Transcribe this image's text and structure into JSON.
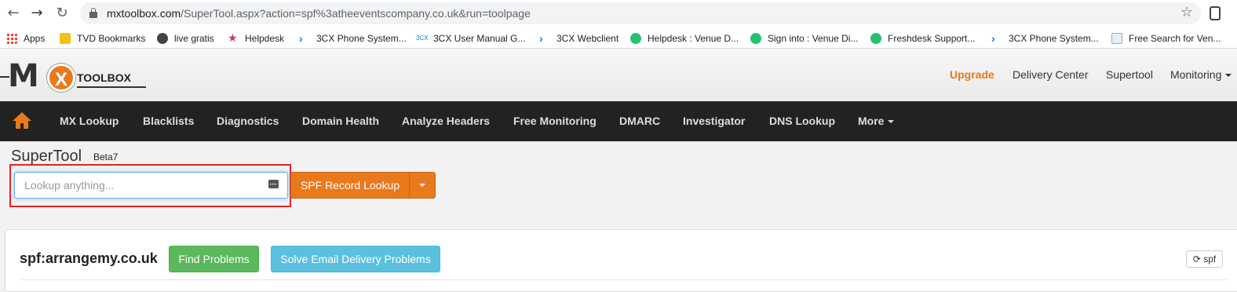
{
  "browser": {
    "url_host": "mxtoolbox.com",
    "url_path": "/SuperTool.aspx?action=spf%3atheeventscompany.co.uk&run=toolpage",
    "bookmarks": [
      {
        "label": "Apps",
        "icon": "apps-grid-icon"
      },
      {
        "label": "TVD Bookmarks",
        "icon": "folder-icon"
      },
      {
        "label": "live gratis",
        "icon": "globe-icon"
      },
      {
        "label": "Helpdesk",
        "icon": "star-icon"
      },
      {
        "label": "3CX Phone System...",
        "icon": "3cx-chevron-icon"
      },
      {
        "label": "3CX User Manual G...",
        "icon": "3cx-logo-icon"
      },
      {
        "label": "3CX Webclient",
        "icon": "3cx-chevron-icon"
      },
      {
        "label": "Helpdesk : Venue D...",
        "icon": "freshdesk-icon"
      },
      {
        "label": "Sign into : Venue Di...",
        "icon": "freshdesk-icon"
      },
      {
        "label": "Freshdesk Support...",
        "icon": "freshdesk-icon"
      },
      {
        "label": "3CX Phone System...",
        "icon": "3cx-chevron-icon"
      },
      {
        "label": "Free Search for Ven...",
        "icon": "document-icon"
      }
    ]
  },
  "header": {
    "logo_text": "TOOLBOX",
    "links": [
      "Upgrade",
      "Delivery Center",
      "Supertool",
      "Monitoring"
    ]
  },
  "nav": {
    "items": [
      "MX Lookup",
      "Blacklists",
      "Diagnostics",
      "Domain Health",
      "Analyze Headers",
      "Free Monitoring",
      "DMARC",
      "Investigator",
      "DNS Lookup",
      "More"
    ]
  },
  "supertool": {
    "title": "SuperTool",
    "beta": "Beta7",
    "placeholder": "Lookup anything...",
    "action_button": "SPF Record Lookup"
  },
  "result": {
    "title": "spf:arrangemy.co.uk",
    "find_problems": "Find Problems",
    "solve_email": "Solve Email Delivery Problems",
    "refresh_label": "spf"
  },
  "colors": {
    "accent_orange": "#e8791d",
    "nav_dark": "#222222",
    "green": "#5cb85c",
    "blue": "#5bc0de",
    "highlight_red": "#e02424"
  }
}
